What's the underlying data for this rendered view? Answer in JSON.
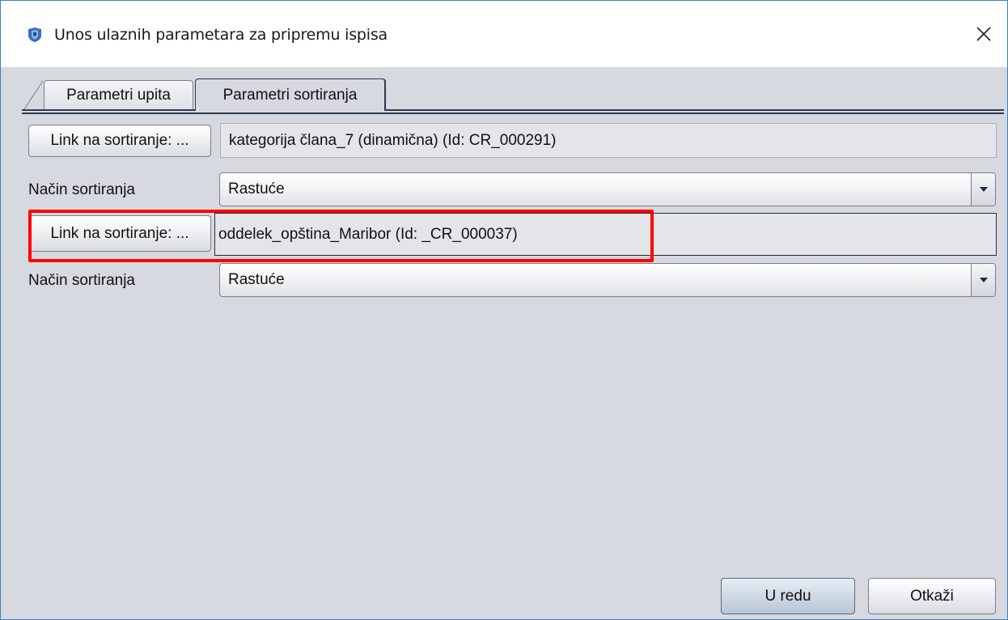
{
  "window": {
    "title": "Unos ulaznih parametara za pripremu ispisa",
    "icon": "app-shield-icon",
    "close_icon": "close-icon"
  },
  "tabs": [
    {
      "label": "Parametri upita",
      "active": false
    },
    {
      "label": "Parametri sortiranja",
      "active": true
    }
  ],
  "sort_rows": [
    {
      "link_button_label": "Link na sortiranje: ...",
      "link_value": "kategorija člana_7 (dinamična) (Id: CR_000291)",
      "order_label": "Način sortiranja",
      "order_value": "Rastuće"
    },
    {
      "link_button_label": "Link na sortiranje: ...",
      "link_value": "oddelek_opština_Maribor (Id: _CR_000037)",
      "order_label": "Način sortiranja",
      "order_value": "Rastuće"
    }
  ],
  "highlight_color": "#ff0000",
  "buttons": {
    "ok": "U redu",
    "cancel": "Otkaži"
  }
}
